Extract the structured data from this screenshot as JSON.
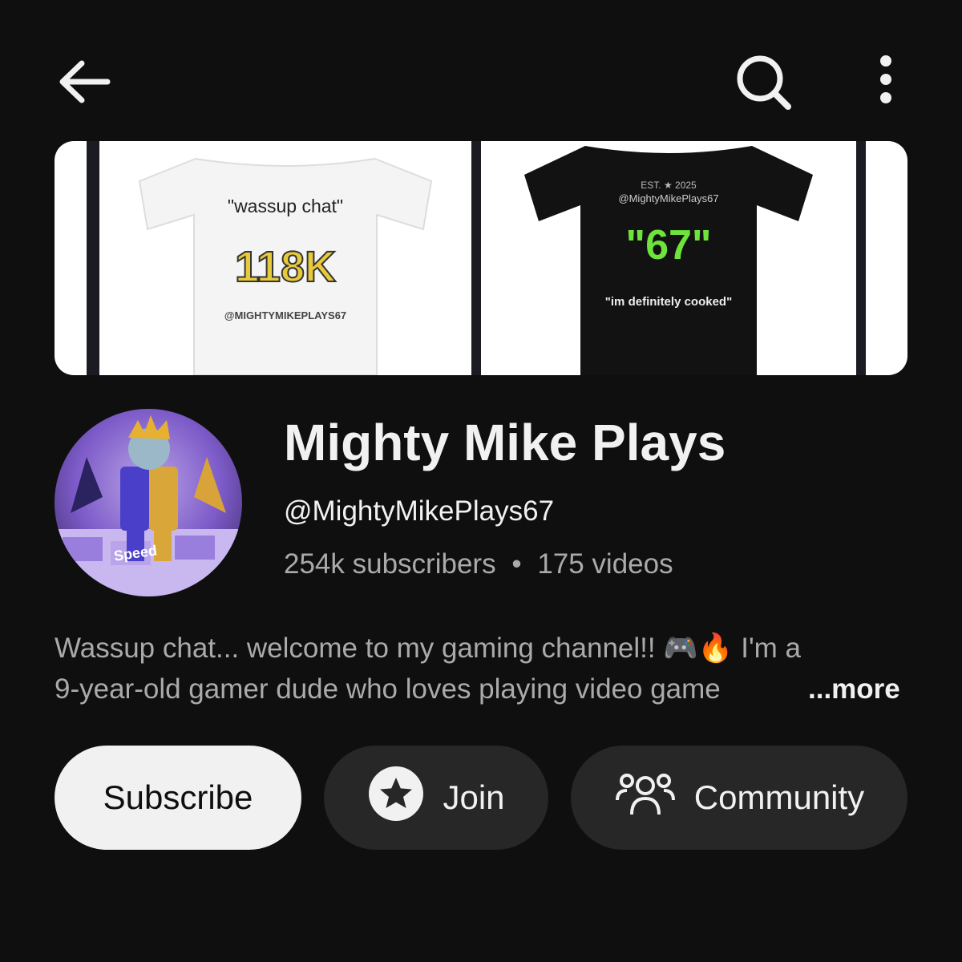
{
  "topbar": {
    "back_icon": "arrow-left-icon",
    "search_icon": "search-icon",
    "more_icon": "more-vertical-icon"
  },
  "banner": {
    "white_shirt": {
      "quote": "\"wassup chat\"",
      "number": "118K",
      "handle": "@MIGHTYMIKEPLAYS67"
    },
    "black_shirt": {
      "est": "EST. ★ 2025",
      "handle": "@MightyMikePlays67",
      "number": "\"67\"",
      "quote": "\"im definitely cooked\""
    }
  },
  "channel": {
    "name": "Mighty Mike Plays",
    "handle": "@MightyMikePlays67",
    "subscribers": "254k subscribers",
    "separator": "•",
    "videos": "175 videos",
    "avatar_text": "Speed"
  },
  "description": {
    "line1_start": "Wassup chat... welcome to my gaming channel!!",
    "line1_emoji": "🎮🔥",
    "line1_end": "I'm a",
    "line2": "9-year-old gamer dude who loves playing video game",
    "more_label": "...more"
  },
  "actions": {
    "subscribe_label": "Subscribe",
    "join_label": "Join",
    "community_label": "Community"
  },
  "colors": {
    "background": "#0f0f0f",
    "text_primary": "#f1f1f1",
    "text_secondary": "#aaaaaa",
    "button_dark": "#272727",
    "button_light": "#f1f1f1",
    "shirt_gold": "#e8c93a",
    "shirt_green": "#6ee33c"
  }
}
